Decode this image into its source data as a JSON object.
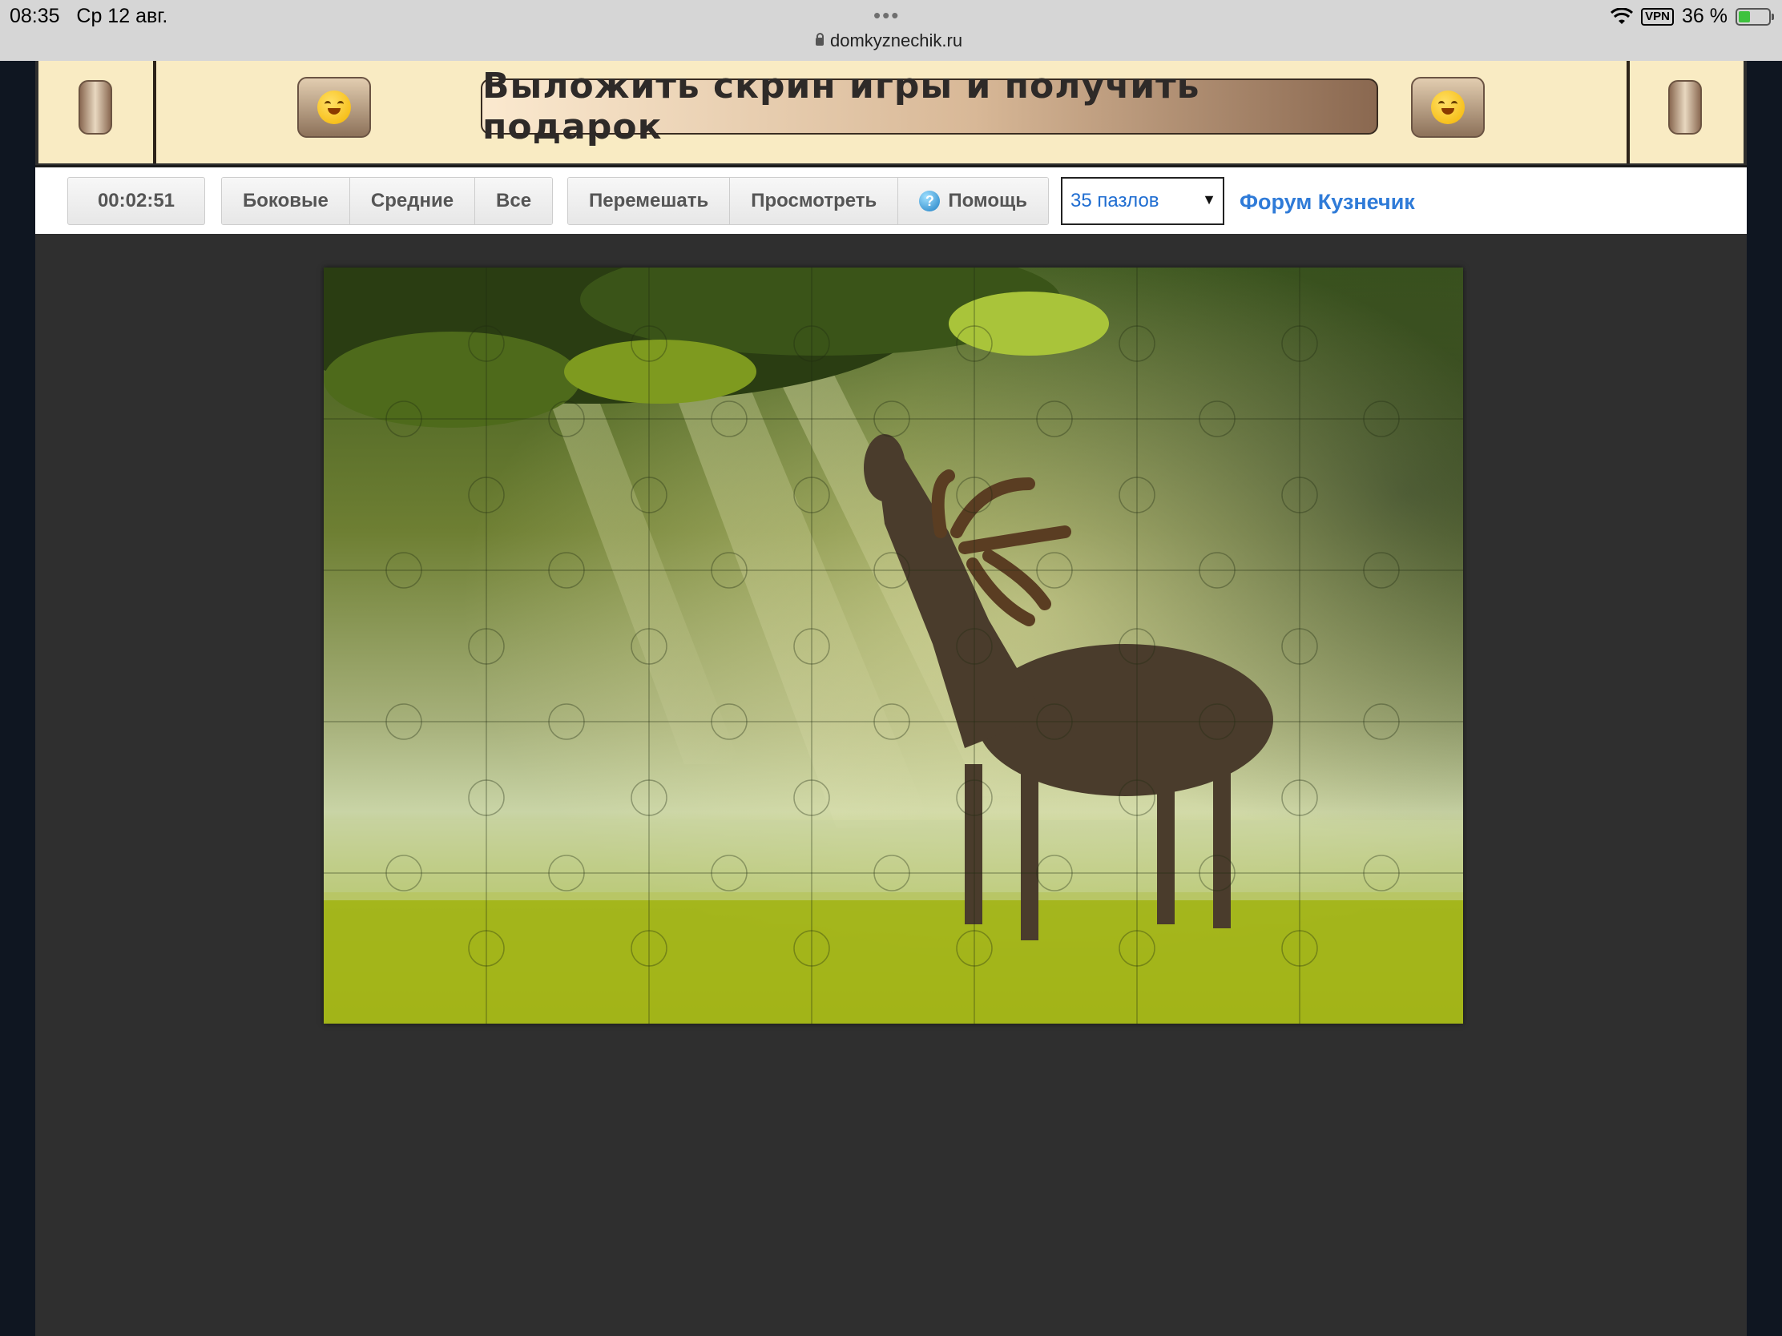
{
  "status_bar": {
    "time": "08:35",
    "date": "Ср 12 авг.",
    "dots": "•••",
    "url": "domkyznechik.ru",
    "vpn": "VPN",
    "battery": "36 %"
  },
  "banner": {
    "cta_label": "Выложить скрин игры и получить подарок"
  },
  "toolbar": {
    "timer": "00:02:51",
    "filter_buttons": [
      "Боковые",
      "Средние",
      "Все"
    ],
    "action_buttons": {
      "shuffle": "Перемешать",
      "preview": "Просмотреть",
      "help": "Помощь",
      "help_icon_glyph": "?"
    },
    "puzzle_count": {
      "selected": "35 пазлов",
      "arrow": "▼"
    },
    "forum_link": "Форум Кузнечик"
  },
  "puzzle": {
    "columns": 7,
    "rows": 5,
    "pieces": 35,
    "image_subject": "deer-in-sunlit-meadow"
  },
  "colors": {
    "page_bg": "#2f2f2f",
    "banner_bg": "#f9ebc3",
    "link": "#2f7bd8",
    "select_text": "#1f6dd1"
  }
}
